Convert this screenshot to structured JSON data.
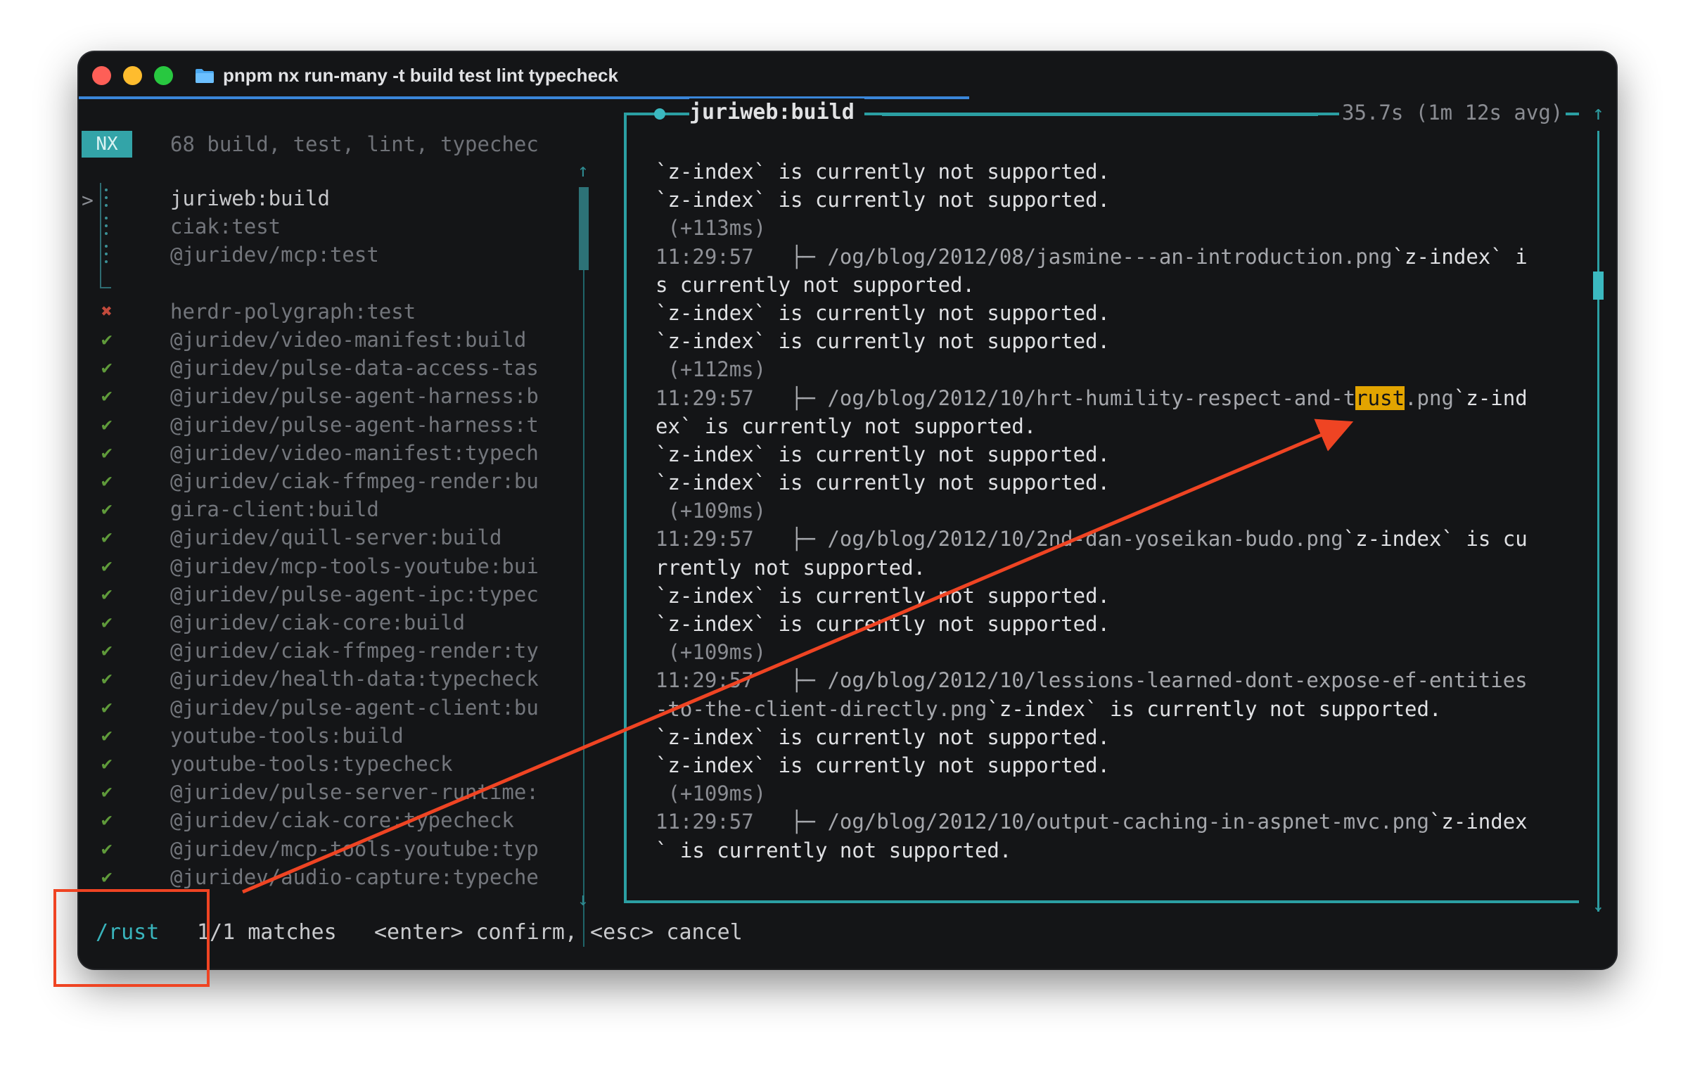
{
  "window": {
    "title": "pnpm nx run-many -t build test lint typecheck"
  },
  "sidebar": {
    "badge": "NX",
    "summary": "68 build, test, lint, typechec",
    "caret": ">",
    "tasks": [
      {
        "status": "",
        "name": "juriweb:build",
        "state": "active"
      },
      {
        "status": "",
        "name": "ciak:test",
        "state": "running"
      },
      {
        "status": "",
        "name": "@juridev/mcp:test",
        "state": "running"
      },
      {
        "status": "✖",
        "name": "herdr-polygraph:test",
        "state": "fail"
      },
      {
        "status": "✔",
        "name": "@juridev/video-manifest:build",
        "state": "ok"
      },
      {
        "status": "✔",
        "name": "@juridev/pulse-data-access-tas",
        "state": "ok"
      },
      {
        "status": "✔",
        "name": "@juridev/pulse-agent-harness:b",
        "state": "ok"
      },
      {
        "status": "✔",
        "name": "@juridev/pulse-agent-harness:t",
        "state": "ok"
      },
      {
        "status": "✔",
        "name": "@juridev/video-manifest:typech",
        "state": "ok"
      },
      {
        "status": "✔",
        "name": "@juridev/ciak-ffmpeg-render:bu",
        "state": "ok"
      },
      {
        "status": "✔",
        "name": "gira-client:build",
        "state": "ok"
      },
      {
        "status": "✔",
        "name": "@juridev/quill-server:build",
        "state": "ok"
      },
      {
        "status": "✔",
        "name": "@juridev/mcp-tools-youtube:bui",
        "state": "ok"
      },
      {
        "status": "✔",
        "name": "@juridev/pulse-agent-ipc:typec",
        "state": "ok"
      },
      {
        "status": "✔",
        "name": "@juridev/ciak-core:build",
        "state": "ok"
      },
      {
        "status": "✔",
        "name": "@juridev/ciak-ffmpeg-render:ty",
        "state": "ok"
      },
      {
        "status": "✔",
        "name": "@juridev/health-data:typecheck",
        "state": "ok"
      },
      {
        "status": "✔",
        "name": "@juridev/pulse-agent-client:bu",
        "state": "ok"
      },
      {
        "status": "✔",
        "name": "youtube-tools:build",
        "state": "ok"
      },
      {
        "status": "✔",
        "name": "youtube-tools:typecheck",
        "state": "ok"
      },
      {
        "status": "✔",
        "name": "@juridev/pulse-server-runtime:",
        "state": "ok"
      },
      {
        "status": "✔",
        "name": "@juridev/ciak-core:typecheck",
        "state": "ok"
      },
      {
        "status": "✔",
        "name": "@juridev/mcp-tools-youtube:typ",
        "state": "ok"
      },
      {
        "status": "✔",
        "name": "@juridev/audio-capture:typeche",
        "state": "ok"
      }
    ],
    "scroll_up": "↑",
    "scroll_down": "↓"
  },
  "output": {
    "task_name": "juriweb:build",
    "duration": "35.7s (1m 12s avg)",
    "scroll_up": "↑",
    "scroll_down": "↓",
    "lines": [
      {
        "kind": "msg",
        "text": "`z-index` is currently not supported."
      },
      {
        "kind": "msg",
        "text": "`z-index` is currently not supported."
      },
      {
        "kind": "delta",
        "text": " (+113ms)"
      },
      {
        "kind": "route",
        "time": "11:29:57",
        "tree": "   ├─ ",
        "path": "/og/blog/2012/08/jasmine---an-introduction.png",
        "tail": "`z-index` i"
      },
      {
        "kind": "msg",
        "text": "s currently not supported."
      },
      {
        "kind": "msg",
        "text": "`z-index` is currently not supported."
      },
      {
        "kind": "msg",
        "text": "`z-index` is currently not supported."
      },
      {
        "kind": "delta",
        "text": " (+112ms)"
      },
      {
        "kind": "route-hl",
        "time": "11:29:57",
        "tree": "   ├─ ",
        "path_pre": "/og/blog/2012/10/hrt-humility-respect-and-t",
        "match": "rust",
        "path_post": ".png",
        "tail": "`z-ind"
      },
      {
        "kind": "msg",
        "text": "ex` is currently not supported."
      },
      {
        "kind": "msg",
        "text": "`z-index` is currently not supported."
      },
      {
        "kind": "msg",
        "text": "`z-index` is currently not supported."
      },
      {
        "kind": "delta",
        "text": " (+109ms)"
      },
      {
        "kind": "route",
        "time": "11:29:57",
        "tree": "   ├─ ",
        "path": "/og/blog/2012/10/2nd-dan-yoseikan-budo.png",
        "tail": "`z-index` is cu"
      },
      {
        "kind": "msg",
        "text": "rrently not supported."
      },
      {
        "kind": "msg",
        "text": "`z-index` is currently not supported."
      },
      {
        "kind": "msg",
        "text": "`z-index` is currently not supported."
      },
      {
        "kind": "delta",
        "text": " (+109ms)"
      },
      {
        "kind": "route",
        "time": "11:29:57",
        "tree": "   ├─ ",
        "path": "/og/blog/2012/10/lessions-learned-dont-expose-ef-entities",
        "tail": ""
      },
      {
        "kind": "pathcont",
        "path": "-to-the-client-directly.png",
        "tail": "`z-index` is currently not supported."
      },
      {
        "kind": "msg",
        "text": "`z-index` is currently not supported."
      },
      {
        "kind": "msg",
        "text": "`z-index` is currently not supported."
      },
      {
        "kind": "delta",
        "text": " (+109ms)"
      },
      {
        "kind": "route",
        "time": "11:29:57",
        "tree": "   ├─ ",
        "path": "/og/blog/2012/10/output-caching-in-aspnet-mvc.png",
        "tail": "`z-index"
      },
      {
        "kind": "msg",
        "text": "` is currently not supported."
      }
    ]
  },
  "search": {
    "query": "/rust",
    "matches": "1/1 matches",
    "hint": "<enter> confirm, <esc> cancel"
  },
  "colors": {
    "accent": "#2b9fa3",
    "highlight": "#e2a400",
    "annotation": "#ef4423",
    "tab_indicator": "#3a86d9"
  },
  "icons": {
    "folder": "folder-icon",
    "success": "check-icon",
    "failure": "cross-icon"
  }
}
